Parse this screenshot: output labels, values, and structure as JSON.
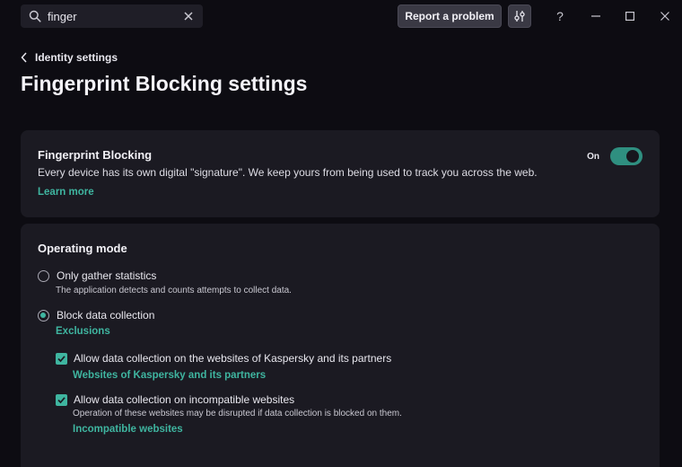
{
  "search": {
    "value": "finger",
    "placeholder": ""
  },
  "toolbar": {
    "report_label": "Report a problem"
  },
  "window": {
    "help": "?"
  },
  "header": {
    "back_label": "Identity settings",
    "title": "Fingerprint Blocking settings"
  },
  "fingerprint": {
    "title": "Fingerprint Blocking",
    "description": "Every device has its own digital \"signature\". We keep yours from being used to track you across the web.",
    "learn_more": "Learn more",
    "toggle_state": "On"
  },
  "mode": {
    "title": "Operating mode",
    "options": [
      {
        "label": "Only gather statistics",
        "description": "The application detects and counts attempts to collect data.",
        "selected": false
      },
      {
        "label": "Block data collection",
        "selected": true
      }
    ],
    "exclusions_link": "Exclusions",
    "checks": [
      {
        "label": "Allow data collection on the websites of Kaspersky and its partners",
        "link": "Websites of Kaspersky and its partners",
        "checked": true
      },
      {
        "label": "Allow data collection on incompatible websites",
        "description": "Operation of these websites may be disrupted if data collection is blocked on them.",
        "link": "Incompatible websites",
        "checked": true
      }
    ]
  },
  "colors": {
    "accent": "#3fb5a0",
    "toggle": "#2f8f80",
    "card": "#1b1a22",
    "background": "#0d0c12"
  }
}
